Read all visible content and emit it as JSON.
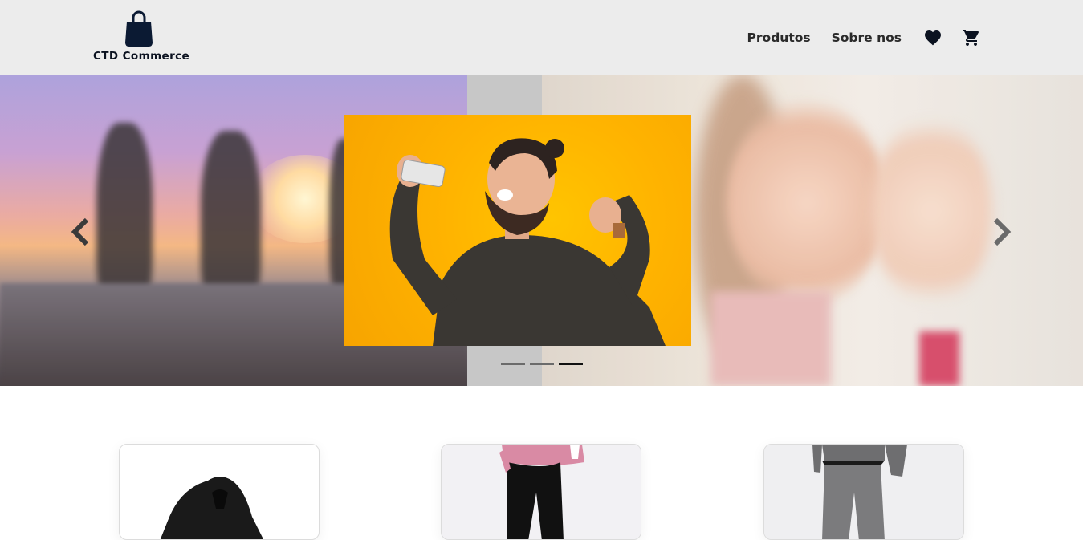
{
  "brand": {
    "name": "CTD Commerce",
    "logo_icon": "shopping-bag-icon",
    "color": "#0b1a33"
  },
  "nav": {
    "products_label": "Produtos",
    "about_label": "Sobre nos",
    "favorites_icon": "heart-icon",
    "cart_icon": "cart-icon"
  },
  "carousel": {
    "slide_count": 3,
    "active_index": 2,
    "prev_icon": "chevron-left-icon",
    "next_icon": "chevron-right-icon"
  },
  "products": [
    {
      "icon": "hoodie-image"
    },
    {
      "icon": "pink-sweater-black-pants-image"
    },
    {
      "icon": "gray-sweatpants-image"
    }
  ],
  "colors": {
    "header_bg": "#ececec",
    "accent_yellow": "#ffb300",
    "dark": "#0b1220"
  }
}
